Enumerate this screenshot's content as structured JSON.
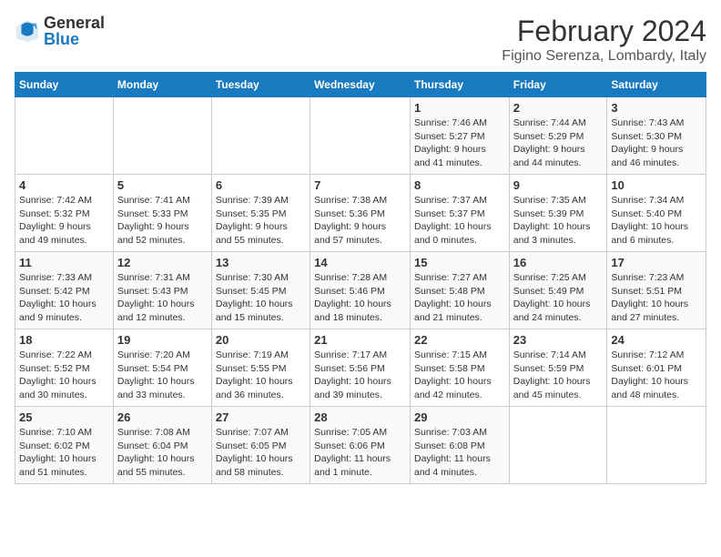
{
  "header": {
    "logo_line1": "General",
    "logo_line2": "Blue",
    "title": "February 2024",
    "subtitle": "Figino Serenza, Lombardy, Italy"
  },
  "days_of_week": [
    "Sunday",
    "Monday",
    "Tuesday",
    "Wednesday",
    "Thursday",
    "Friday",
    "Saturday"
  ],
  "weeks": [
    [
      {
        "day": "",
        "info": ""
      },
      {
        "day": "",
        "info": ""
      },
      {
        "day": "",
        "info": ""
      },
      {
        "day": "",
        "info": ""
      },
      {
        "day": "1",
        "info": "Sunrise: 7:46 AM\nSunset: 5:27 PM\nDaylight: 9 hours\nand 41 minutes."
      },
      {
        "day": "2",
        "info": "Sunrise: 7:44 AM\nSunset: 5:29 PM\nDaylight: 9 hours\nand 44 minutes."
      },
      {
        "day": "3",
        "info": "Sunrise: 7:43 AM\nSunset: 5:30 PM\nDaylight: 9 hours\nand 46 minutes."
      }
    ],
    [
      {
        "day": "4",
        "info": "Sunrise: 7:42 AM\nSunset: 5:32 PM\nDaylight: 9 hours\nand 49 minutes."
      },
      {
        "day": "5",
        "info": "Sunrise: 7:41 AM\nSunset: 5:33 PM\nDaylight: 9 hours\nand 52 minutes."
      },
      {
        "day": "6",
        "info": "Sunrise: 7:39 AM\nSunset: 5:35 PM\nDaylight: 9 hours\nand 55 minutes."
      },
      {
        "day": "7",
        "info": "Sunrise: 7:38 AM\nSunset: 5:36 PM\nDaylight: 9 hours\nand 57 minutes."
      },
      {
        "day": "8",
        "info": "Sunrise: 7:37 AM\nSunset: 5:37 PM\nDaylight: 10 hours\nand 0 minutes."
      },
      {
        "day": "9",
        "info": "Sunrise: 7:35 AM\nSunset: 5:39 PM\nDaylight: 10 hours\nand 3 minutes."
      },
      {
        "day": "10",
        "info": "Sunrise: 7:34 AM\nSunset: 5:40 PM\nDaylight: 10 hours\nand 6 minutes."
      }
    ],
    [
      {
        "day": "11",
        "info": "Sunrise: 7:33 AM\nSunset: 5:42 PM\nDaylight: 10 hours\nand 9 minutes."
      },
      {
        "day": "12",
        "info": "Sunrise: 7:31 AM\nSunset: 5:43 PM\nDaylight: 10 hours\nand 12 minutes."
      },
      {
        "day": "13",
        "info": "Sunrise: 7:30 AM\nSunset: 5:45 PM\nDaylight: 10 hours\nand 15 minutes."
      },
      {
        "day": "14",
        "info": "Sunrise: 7:28 AM\nSunset: 5:46 PM\nDaylight: 10 hours\nand 18 minutes."
      },
      {
        "day": "15",
        "info": "Sunrise: 7:27 AM\nSunset: 5:48 PM\nDaylight: 10 hours\nand 21 minutes."
      },
      {
        "day": "16",
        "info": "Sunrise: 7:25 AM\nSunset: 5:49 PM\nDaylight: 10 hours\nand 24 minutes."
      },
      {
        "day": "17",
        "info": "Sunrise: 7:23 AM\nSunset: 5:51 PM\nDaylight: 10 hours\nand 27 minutes."
      }
    ],
    [
      {
        "day": "18",
        "info": "Sunrise: 7:22 AM\nSunset: 5:52 PM\nDaylight: 10 hours\nand 30 minutes."
      },
      {
        "day": "19",
        "info": "Sunrise: 7:20 AM\nSunset: 5:54 PM\nDaylight: 10 hours\nand 33 minutes."
      },
      {
        "day": "20",
        "info": "Sunrise: 7:19 AM\nSunset: 5:55 PM\nDaylight: 10 hours\nand 36 minutes."
      },
      {
        "day": "21",
        "info": "Sunrise: 7:17 AM\nSunset: 5:56 PM\nDaylight: 10 hours\nand 39 minutes."
      },
      {
        "day": "22",
        "info": "Sunrise: 7:15 AM\nSunset: 5:58 PM\nDaylight: 10 hours\nand 42 minutes."
      },
      {
        "day": "23",
        "info": "Sunrise: 7:14 AM\nSunset: 5:59 PM\nDaylight: 10 hours\nand 45 minutes."
      },
      {
        "day": "24",
        "info": "Sunrise: 7:12 AM\nSunset: 6:01 PM\nDaylight: 10 hours\nand 48 minutes."
      }
    ],
    [
      {
        "day": "25",
        "info": "Sunrise: 7:10 AM\nSunset: 6:02 PM\nDaylight: 10 hours\nand 51 minutes."
      },
      {
        "day": "26",
        "info": "Sunrise: 7:08 AM\nSunset: 6:04 PM\nDaylight: 10 hours\nand 55 minutes."
      },
      {
        "day": "27",
        "info": "Sunrise: 7:07 AM\nSunset: 6:05 PM\nDaylight: 10 hours\nand 58 minutes."
      },
      {
        "day": "28",
        "info": "Sunrise: 7:05 AM\nSunset: 6:06 PM\nDaylight: 11 hours\nand 1 minute."
      },
      {
        "day": "29",
        "info": "Sunrise: 7:03 AM\nSunset: 6:08 PM\nDaylight: 11 hours\nand 4 minutes."
      },
      {
        "day": "",
        "info": ""
      },
      {
        "day": "",
        "info": ""
      }
    ]
  ]
}
